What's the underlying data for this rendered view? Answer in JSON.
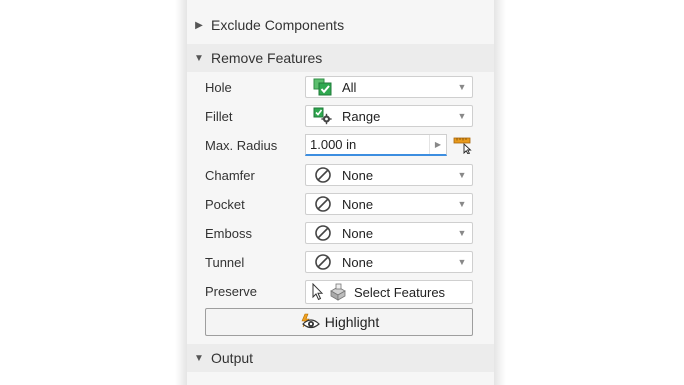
{
  "sections": {
    "exclude_components": {
      "label": "Exclude Components",
      "expanded": false
    },
    "remove_features": {
      "label": "Remove Features",
      "expanded": true
    },
    "output": {
      "label": "Output",
      "expanded": true
    }
  },
  "rows": [
    {
      "label": "Hole",
      "value": "All",
      "icon": "checked-box-icon"
    },
    {
      "label": "Fillet",
      "value": "Range",
      "icon": "range-settings-icon"
    },
    {
      "label": "Max. Radius",
      "value": "1.000 in"
    },
    {
      "label": "Chamfer",
      "value": "None",
      "icon": "none-icon"
    },
    {
      "label": "Pocket",
      "value": "None",
      "icon": "none-icon"
    },
    {
      "label": "Emboss",
      "value": "None",
      "icon": "none-icon"
    },
    {
      "label": "Tunnel",
      "value": "None",
      "icon": "none-icon"
    },
    {
      "label": "Preserve",
      "value": "Select Features",
      "icon": "select-pointer-icon"
    }
  ],
  "highlight_button": {
    "label": "Highlight"
  },
  "colors": {
    "panel_bg": "#f6f6f6",
    "header_bg": "#ececec",
    "accent_blue": "#3d8ee0",
    "check_green": "#2fa84f",
    "measure_orange": "#e89a1c"
  }
}
